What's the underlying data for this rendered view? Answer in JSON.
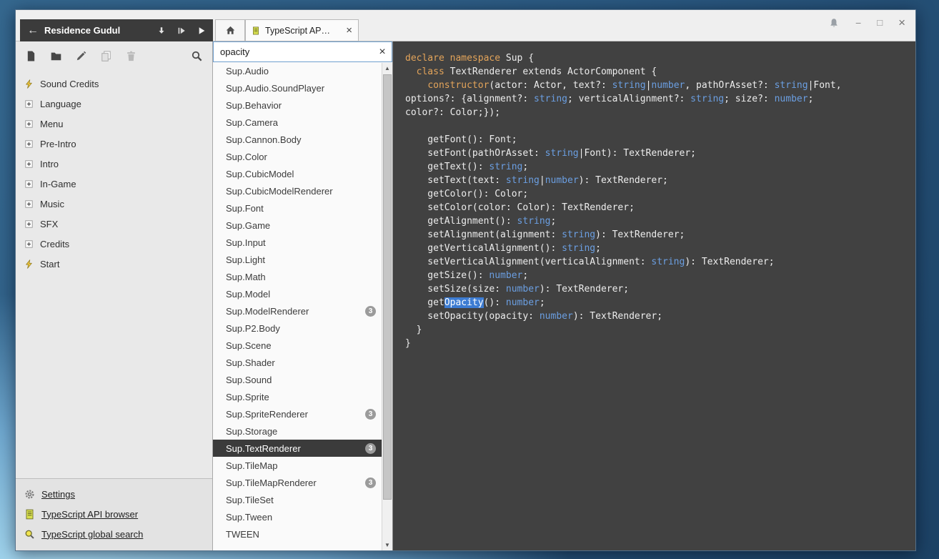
{
  "colors": {
    "keyword_orange": "#e3a45a",
    "type_blue": "#6b9fe2",
    "match_highlight_blue": "#3d7cd2",
    "editor_background": "#414141",
    "selected_item_background": "#3b3b3b",
    "badge_gray": "#9b9b9b",
    "script_icon_yellow": "#d8e04e",
    "lightning_yellow": "#eec43a"
  },
  "window": {
    "project_header": {
      "back_glyph": "←",
      "title": "Residence Gudul",
      "actions": [
        "download",
        "run",
        "play"
      ]
    },
    "tab": {
      "label": "TypeScript AP…",
      "close_glyph": "×"
    },
    "window_controls": [
      {
        "name": "notifications",
        "icon": "bell"
      },
      {
        "name": "minimize",
        "glyph": "−"
      },
      {
        "name": "maximize",
        "glyph": "□"
      },
      {
        "name": "close",
        "glyph": "×"
      }
    ],
    "sidebar": {
      "toolbar": [
        {
          "name": "new-asset",
          "icon": "new-asset",
          "disabled": false
        },
        {
          "name": "new-folder",
          "icon": "new-folder",
          "disabled": false
        },
        {
          "name": "rename",
          "icon": "rename",
          "disabled": false
        },
        {
          "name": "duplicate",
          "icon": "duplicate",
          "disabled": true
        },
        {
          "name": "trash",
          "icon": "trash",
          "disabled": true
        },
        {
          "name": "search",
          "icon": "search",
          "disabled": false,
          "align": "right"
        }
      ],
      "tree": [
        {
          "icon": "lightning",
          "label": "Sound Credits"
        },
        {
          "icon": "plusbox",
          "label": "Language"
        },
        {
          "icon": "plusbox",
          "label": "Menu"
        },
        {
          "icon": "plusbox",
          "label": "Pre-Intro"
        },
        {
          "icon": "plusbox",
          "label": "Intro"
        },
        {
          "icon": "plusbox",
          "label": "In-Game"
        },
        {
          "icon": "plusbox",
          "label": "Music"
        },
        {
          "icon": "plusbox",
          "label": "SFX"
        },
        {
          "icon": "plusbox",
          "label": "Credits"
        },
        {
          "icon": "lightning",
          "label": "Start"
        }
      ],
      "footer_links": [
        {
          "icon": "gear",
          "label": "Settings"
        },
        {
          "icon": "script",
          "label": "TypeScript API browser"
        },
        {
          "icon": "search-yellow",
          "label": "TypeScript global search"
        }
      ]
    },
    "api_browser": {
      "search_value": "opacity",
      "clear_glyph": "×",
      "scrollbar": {
        "up_glyph": "▲",
        "down_glyph": "▼"
      },
      "items": [
        {
          "label": "Sup.Audio"
        },
        {
          "label": "Sup.Audio.SoundPlayer"
        },
        {
          "label": "Sup.Behavior"
        },
        {
          "label": "Sup.Camera"
        },
        {
          "label": "Sup.Cannon.Body"
        },
        {
          "label": "Sup.Color"
        },
        {
          "label": "Sup.CubicModel"
        },
        {
          "label": "Sup.CubicModelRenderer"
        },
        {
          "label": "Sup.Font"
        },
        {
          "label": "Sup.Game"
        },
        {
          "label": "Sup.Input"
        },
        {
          "label": "Sup.Light"
        },
        {
          "label": "Sup.Math"
        },
        {
          "label": "Sup.Model"
        },
        {
          "label": "Sup.ModelRenderer",
          "badge": "3"
        },
        {
          "label": "Sup.P2.Body"
        },
        {
          "label": "Sup.Scene"
        },
        {
          "label": "Sup.Shader"
        },
        {
          "label": "Sup.Sound"
        },
        {
          "label": "Sup.Sprite"
        },
        {
          "label": "Sup.SpriteRenderer",
          "badge": "3"
        },
        {
          "label": "Sup.Storage"
        },
        {
          "label": "Sup.TextRenderer",
          "badge": "3",
          "selected": true
        },
        {
          "label": "Sup.TileMap"
        },
        {
          "label": "Sup.TileMapRenderer",
          "badge": "3"
        },
        {
          "label": "Sup.TileSet"
        },
        {
          "label": "Sup.Tween"
        },
        {
          "label": "TWEEN"
        }
      ]
    },
    "editor": {
      "lines": [
        [
          [
            "kw",
            "declare"
          ],
          [
            "p",
            " "
          ],
          [
            "kw",
            "namespace"
          ],
          [
            "p",
            " Sup {"
          ]
        ],
        [
          [
            "p",
            "  "
          ],
          [
            "kw",
            "class"
          ],
          [
            "p",
            " TextRenderer extends ActorComponent {"
          ]
        ],
        [
          [
            "p",
            "    "
          ],
          [
            "kw",
            "constructor"
          ],
          [
            "p",
            "(actor: Actor, text?: "
          ],
          [
            "t",
            "string"
          ],
          [
            "p",
            "|"
          ],
          [
            "t",
            "number"
          ],
          [
            "p",
            ", pathOrAsset?: "
          ],
          [
            "t",
            "string"
          ],
          [
            "p",
            "|Font,"
          ]
        ],
        [
          [
            "p",
            "options?: {alignment?: "
          ],
          [
            "t",
            "string"
          ],
          [
            "p",
            "; verticalAlignment?: "
          ],
          [
            "t",
            "string"
          ],
          [
            "p",
            "; size?: "
          ],
          [
            "t",
            "number"
          ],
          [
            "p",
            ";"
          ]
        ],
        [
          [
            "p",
            "color?: Color;});"
          ]
        ],
        [],
        [
          [
            "p",
            "    getFont(): Font;"
          ]
        ],
        [
          [
            "p",
            "    setFont(pathOrAsset: "
          ],
          [
            "t",
            "string"
          ],
          [
            "p",
            "|Font): TextRenderer;"
          ]
        ],
        [
          [
            "p",
            "    getText(): "
          ],
          [
            "t",
            "string"
          ],
          [
            "p",
            ";"
          ]
        ],
        [
          [
            "p",
            "    setText(text: "
          ],
          [
            "t",
            "string"
          ],
          [
            "p",
            "|"
          ],
          [
            "t",
            "number"
          ],
          [
            "p",
            "): TextRenderer;"
          ]
        ],
        [
          [
            "p",
            "    getColor(): Color;"
          ]
        ],
        [
          [
            "p",
            "    setColor(color: Color): TextRenderer;"
          ]
        ],
        [
          [
            "p",
            "    getAlignment(): "
          ],
          [
            "t",
            "string"
          ],
          [
            "p",
            ";"
          ]
        ],
        [
          [
            "p",
            "    setAlignment(alignment: "
          ],
          [
            "t",
            "string"
          ],
          [
            "p",
            "): TextRenderer;"
          ]
        ],
        [
          [
            "p",
            "    getVerticalAlignment(): "
          ],
          [
            "t",
            "string"
          ],
          [
            "p",
            ";"
          ]
        ],
        [
          [
            "p",
            "    setVerticalAlignment(verticalAlignment: "
          ],
          [
            "t",
            "string"
          ],
          [
            "p",
            "): TextRenderer;"
          ]
        ],
        [
          [
            "p",
            "    getSize(): "
          ],
          [
            "t",
            "number"
          ],
          [
            "p",
            ";"
          ]
        ],
        [
          [
            "p",
            "    setSize(size: "
          ],
          [
            "t",
            "number"
          ],
          [
            "p",
            "): TextRenderer;"
          ]
        ],
        [
          [
            "p",
            "    get"
          ],
          [
            "hl",
            "Opacity"
          ],
          [
            "p",
            "(): "
          ],
          [
            "t",
            "number"
          ],
          [
            "p",
            ";"
          ]
        ],
        [
          [
            "p",
            "    setOpacity(opacity: "
          ],
          [
            "t",
            "number"
          ],
          [
            "p",
            "): TextRenderer;"
          ]
        ],
        [
          [
            "p",
            "  }"
          ]
        ],
        [
          [
            "p",
            "}"
          ]
        ]
      ]
    }
  }
}
